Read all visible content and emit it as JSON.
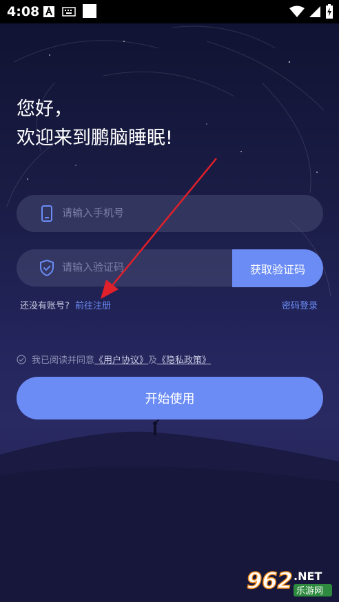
{
  "status_bar": {
    "time": "4:08"
  },
  "greeting": {
    "line1": "您好，",
    "line2": "欢迎来到鹏脑睡眠!"
  },
  "phone_field": {
    "placeholder": "请输入手机号",
    "icon": "phone-icon"
  },
  "code_field": {
    "placeholder": "请输入验证码",
    "icon": "shield-icon"
  },
  "get_code_button": {
    "label": "获取验证码"
  },
  "register": {
    "prompt": "还没有账号?",
    "link": "前往注册"
  },
  "password_login": {
    "label": "密码登录"
  },
  "agreement": {
    "prefix": "我已阅读并同意",
    "user_agreement": "《用户协议》",
    "and": "及",
    "privacy_policy": "《隐私政策》"
  },
  "start_button": {
    "label": "开始使用"
  },
  "watermark": {
    "number": "962",
    "suffix": ".NET",
    "site": "乐游网"
  },
  "colors": {
    "accent": "#6b8cf5",
    "background": "#1b1d47",
    "arrow": "#e0202a"
  }
}
